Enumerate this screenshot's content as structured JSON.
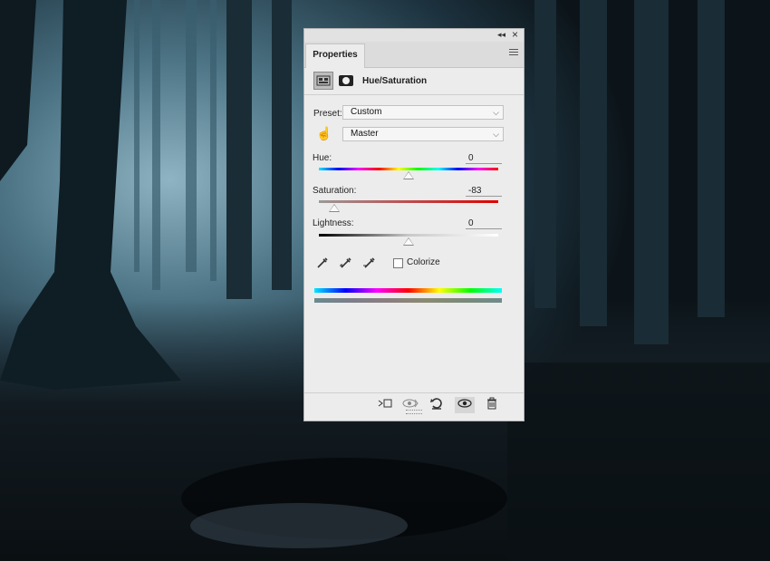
{
  "panel": {
    "tab_label": "Properties",
    "adjustment_title": "Hue/Saturation",
    "preset_label": "Preset:",
    "preset_value": "Custom",
    "channel_value": "Master",
    "hue_label": "Hue:",
    "hue_value": "0",
    "saturation_label": "Saturation:",
    "saturation_value": "-83",
    "lightness_label": "Lightness:",
    "lightness_value": "0",
    "colorize_label": "Colorize",
    "colorize_checked": false
  },
  "sliders": {
    "hue": {
      "min": -180,
      "max": 180,
      "value": 0
    },
    "saturation": {
      "min": -100,
      "max": 100,
      "value": -83
    },
    "lightness": {
      "min": -100,
      "max": 100,
      "value": 0
    }
  },
  "icons": {
    "collapse": "double-chevron-left-icon",
    "close": "close-icon",
    "menu": "panel-menu-icon",
    "adjustment": "hue-saturation-adjustment-icon",
    "mask": "layer-mask-icon",
    "targeted": "hand-targeted-adjustment-icon",
    "eyedroppers": [
      "eyedropper-icon",
      "eyedropper-plus-icon",
      "eyedropper-minus-icon"
    ],
    "bottom": [
      "clip-to-layer-icon",
      "view-previous-state-icon",
      "reset-icon",
      "visibility-eye-icon",
      "trash-icon"
    ]
  }
}
